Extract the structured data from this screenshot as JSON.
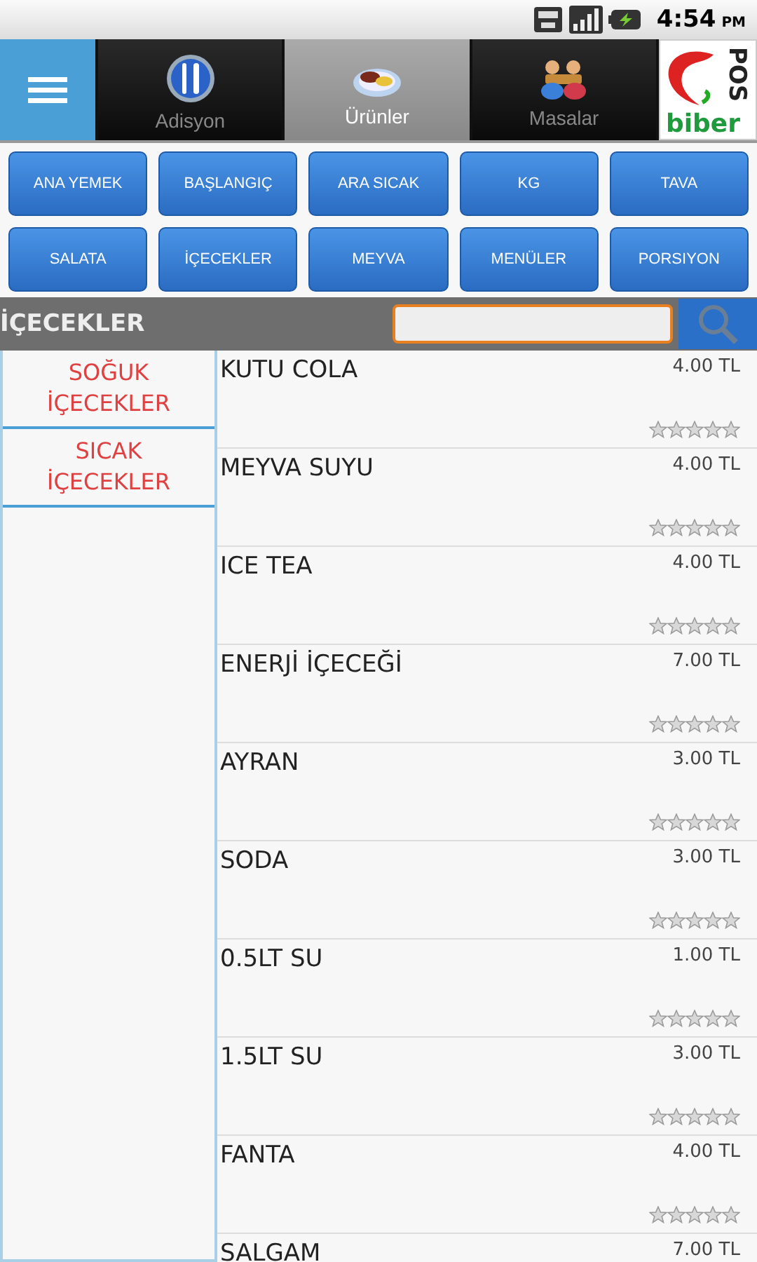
{
  "status_bar": {
    "time": "4:54",
    "meridiem": "PM"
  },
  "tabs": [
    {
      "label": "Adisyon",
      "selected": false
    },
    {
      "label": "Ürünler",
      "selected": true
    },
    {
      "label": "Masalar",
      "selected": false
    }
  ],
  "logo": {
    "vertical": "POS",
    "word": "biber"
  },
  "categories": [
    "ANA YEMEK",
    "BAŞLANGIÇ",
    "ARA SICAK",
    "KG",
    "TAVA",
    "SALATA",
    "İÇECEKLER",
    "MEYVA",
    "MENÜLER",
    "PORSIYON"
  ],
  "section": {
    "title": "İÇECEKLER"
  },
  "subcategories": [
    "SOĞUK İÇECEKLER",
    "SICAK İÇECEKLER"
  ],
  "products": [
    {
      "name": "KUTU COLA",
      "price": "4.00 TL",
      "stars": 0
    },
    {
      "name": "MEYVA SUYU",
      "price": "4.00 TL",
      "stars": 0
    },
    {
      "name": "ICE TEA",
      "price": "4.00 TL",
      "stars": 0
    },
    {
      "name": "ENERJİ İÇECEĞİ",
      "price": "7.00 TL",
      "stars": 0
    },
    {
      "name": "AYRAN",
      "price": "3.00 TL",
      "stars": 0
    },
    {
      "name": "SODA",
      "price": "3.00 TL",
      "stars": 0
    },
    {
      "name": "0.5LT SU",
      "price": "1.00 TL",
      "stars": 0
    },
    {
      "name": "1.5LT SU",
      "price": "3.00 TL",
      "stars": 0
    },
    {
      "name": "FANTA",
      "price": "4.00 TL",
      "stars": 0
    },
    {
      "name": "SALGAM",
      "price": "7.00 TL"
    }
  ]
}
